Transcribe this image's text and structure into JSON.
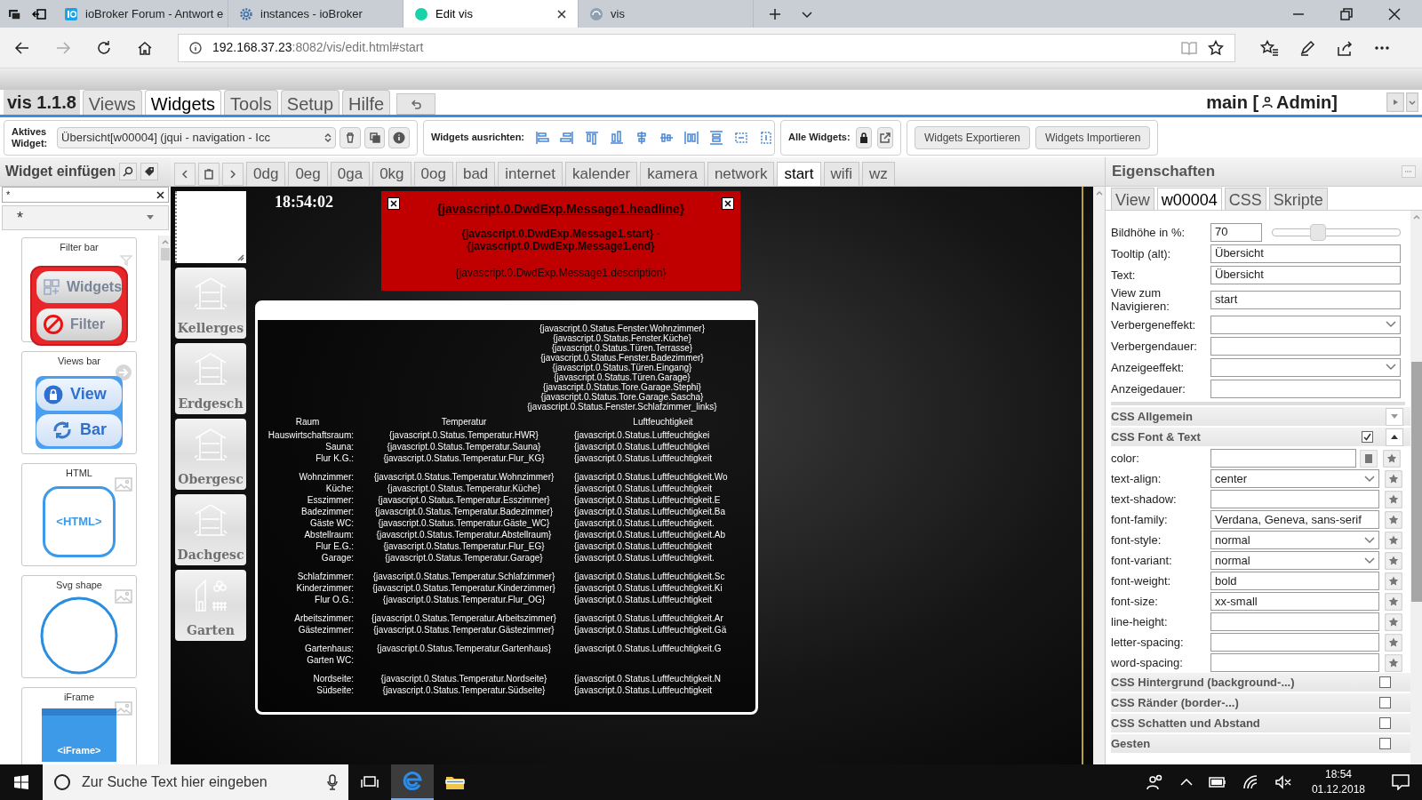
{
  "browser": {
    "tabs": [
      {
        "title": "ioBroker Forum - Antwort e",
        "kind": "logo",
        "selected": false
      },
      {
        "title": "instances - ioBroker",
        "kind": "gear",
        "selected": false
      },
      {
        "title": "Edit vis",
        "kind": "teal",
        "selected": true
      },
      {
        "title": "vis",
        "kind": "grey",
        "selected": false
      }
    ],
    "url_host": "192.168.37.23",
    "url_rest": ":8082/vis/edit.html#start"
  },
  "app": {
    "version": "vis 1.1.8",
    "menu": [
      {
        "label": "Views",
        "selected": false
      },
      {
        "label": "Widgets",
        "selected": true
      },
      {
        "label": "Tools",
        "selected": false
      },
      {
        "label": "Setup",
        "selected": false
      },
      {
        "label": "Hilfe",
        "selected": false
      }
    ],
    "project": "main [",
    "user": "Admin]"
  },
  "toolbar": {
    "active_widget_label": "Aktives Widget:",
    "active_widget": "Übersicht[w00004] (jqui - navigation - Icc",
    "align_label": "Widgets ausrichten:",
    "all_widgets_label": "Alle Widgets:",
    "buttons": [
      "Widgets Exportieren",
      "Widgets Importieren"
    ]
  },
  "palette": {
    "title": "Widget einfügen",
    "filter": "*",
    "set": "*",
    "widgets": [
      {
        "title": "Filter bar",
        "kind": "filter",
        "labels": [
          "Widgets",
          "Filter"
        ]
      },
      {
        "title": "Views bar",
        "kind": "views",
        "labels": [
          "View",
          "Bar"
        ]
      },
      {
        "title": "HTML",
        "kind": "html",
        "labels": [
          "<HTML>"
        ]
      },
      {
        "title": "Svg shape",
        "kind": "svg"
      },
      {
        "title": "iFrame",
        "kind": "iframe",
        "labels": [
          "<iFrame>"
        ]
      }
    ]
  },
  "views": [
    {
      "label": "0dg",
      "selected": false
    },
    {
      "label": "0eg",
      "selected": false
    },
    {
      "label": "0ga",
      "selected": false
    },
    {
      "label": "0kg",
      "selected": false
    },
    {
      "label": "0og",
      "selected": false
    },
    {
      "label": "bad",
      "selected": false
    },
    {
      "label": "internet",
      "selected": false
    },
    {
      "label": "kalender",
      "selected": false
    },
    {
      "label": "kamera",
      "selected": false
    },
    {
      "label": "network",
      "selected": false
    },
    {
      "label": "start",
      "selected": true
    },
    {
      "label": "wifi",
      "selected": false
    },
    {
      "label": "wz",
      "selected": false
    }
  ],
  "canvas": {
    "clock": "18:54:02",
    "nav_buttons": [
      "Kellerges",
      "Erdgesch",
      "Obergesc",
      "Dachgesc",
      "Garten"
    ],
    "alert": {
      "headline": "{javascript.0.DwdExp.Message1.headline}",
      "period_start": "{javascript.0.DwdExp.Message1.start} -",
      "period_end": "{javascript.0.DwdExp.Message1.end}",
      "description": "{javascript.0.DwdExp.Message1.description}"
    },
    "status_lines": [
      "{javascript.0.Status.Fenster.Wohnzimmer}",
      "{javascript.0.Status.Fenster.Küche}",
      "{javascript.0.Status.Türen.Terrasse}",
      "{javascript.0.Status.Fenster.Badezimmer}",
      "{javascript.0.Status.Türen.Eingang}",
      "{javascript.0.Status.Türen.Garage}",
      "{javascript.0.Status.Tore.Garage.Stephi}",
      "{javascript.0.Status.Tore.Garage.Sascha}",
      "{javascript.0.Status.Fenster.Schlafzimmer_links}"
    ],
    "table": {
      "columns": [
        "Raum",
        "Temperatur",
        "Luftfeuchtigkeit"
      ],
      "groups": [
        [
          {
            "room": "Hauswirtschaftsraum:",
            "temperature": "{javascript.0.Status.Temperatur.HWR}",
            "humidity": "{javascript.0.Status.Luftfeuchtigkei"
          },
          {
            "room": "Sauna:",
            "temperature": "{javascript.0.Status.Temperatur.Sauna}",
            "humidity": "{javascript.0.Status.Luftfeuchtigkei"
          },
          {
            "room": "Flur K.G.:",
            "temperature": "{javascript.0.Status.Temperatur.Flur_KG}",
            "humidity": "{javascript.0.Status.Luftfeuchtigkeit"
          }
        ],
        [
          {
            "room": "Wohnzimmer:",
            "temperature": "{javascript.0.Status.Temperatur.Wohnzimmer}",
            "humidity": "{javascript.0.Status.Luftfeuchtigkeit.Wo"
          },
          {
            "room": "Küche:",
            "temperature": "{javascript.0.Status.Temperatur.Küche}",
            "humidity": "{javascript.0.Status.Luftfeuchtigkeit"
          },
          {
            "room": "Esszimmer:",
            "temperature": "{javascript.0.Status.Temperatur.Esszimmer}",
            "humidity": "{javascript.0.Status.Luftfeuchtigkeit.E"
          },
          {
            "room": "Badezimmer:",
            "temperature": "{javascript.0.Status.Temperatur.Badezimmer}",
            "humidity": "{javascript.0.Status.Luftfeuchtigkeit.Ba"
          },
          {
            "room": "Gäste WC:",
            "temperature": "{javascript.0.Status.Temperatur.Gäste_WC}",
            "humidity": "{javascript.0.Status.Luftfeuchtigkeit."
          },
          {
            "room": "Abstellraum:",
            "temperature": "{javascript.0.Status.Temperatur.Abstellraum}",
            "humidity": "{javascript.0.Status.Luftfeuchtigkeit.Ab"
          },
          {
            "room": "Flur E.G.:",
            "temperature": "{javascript.0.Status.Temperatur.Flur_EG}",
            "humidity": "{javascript.0.Status.Luftfeuchtigkeit"
          },
          {
            "room": "Garage:",
            "temperature": "{javascript.0.Status.Temperatur.Garage}",
            "humidity": "{javascript.0.Status.Luftfeuchtigkeit."
          }
        ],
        [
          {
            "room": "Schlafzimmer:",
            "temperature": "{javascript.0.Status.Temperatur.Schlafzimmer}",
            "humidity": "{javascript.0.Status.Luftfeuchtigkeit.Sc"
          },
          {
            "room": "Kinderzimmer:",
            "temperature": "{javascript.0.Status.Temperatur.Kinderzimmer}",
            "humidity": "{javascript.0.Status.Luftfeuchtigkeit.Ki"
          },
          {
            "room": "Flur O.G.:",
            "temperature": "{javascript.0.Status.Temperatur.Flur_OG}",
            "humidity": "{javascript.0.Status.Luftfeuchtigkeit"
          }
        ],
        [
          {
            "room": "Arbeitszimmer:",
            "temperature": "{javascript.0.Status.Temperatur.Arbeitszimmer}",
            "humidity": "{javascript.0.Status.Luftfeuchtigkeit.Ar"
          },
          {
            "room": "Gästezimmer:",
            "temperature": "{javascript.0.Status.Temperatur.Gästezimmer}",
            "humidity": "{javascript.0.Status.Luftfeuchtigkeit.Gä"
          }
        ],
        [
          {
            "room": "Gartenhaus:",
            "temperature": "{javascript.0.Status.Temperatur.Gartenhaus}",
            "humidity": "{javascript.0.Status.Luftfeuchtigkeit.G"
          },
          {
            "room": "Garten WC:"
          }
        ],
        [
          {
            "room": "Nordseite:",
            "temperature": "{javascript.0.Status.Temperatur.Nordseite}",
            "humidity": "{javascript.0.Status.Luftfeuchtigkeit.N"
          },
          {
            "room": "Südseite:",
            "temperature": "{javascript.0.Status.Temperatur.Südseite}",
            "humidity": "{javascript.0.Status.Luftfeuchtigkeit"
          }
        ]
      ]
    }
  },
  "properties": {
    "title": "Eigenschaften",
    "tabs": [
      {
        "label": "View",
        "selected": false
      },
      {
        "label": "w00004",
        "selected": true
      },
      {
        "label": "CSS",
        "selected": false
      },
      {
        "label": "Skripte",
        "selected": false
      }
    ],
    "fields": [
      {
        "label": "Bildhöhe in %:",
        "value": "70",
        "kind": "slider",
        "level": 0.35
      },
      {
        "label": "Tooltip (alt):",
        "value": "Übersicht",
        "kind": "input"
      },
      {
        "label": "Text:",
        "value": "Übersicht",
        "kind": "input"
      },
      {
        "label": "View zum Navigieren:",
        "value": "start",
        "kind": "input"
      },
      {
        "label": "Verbergeneffekt:",
        "kind": "select"
      },
      {
        "label": "Verbergendauer:",
        "kind": "input"
      },
      {
        "label": "Anzeigeeffekt:",
        "kind": "select"
      },
      {
        "label": "Anzeigedauer:",
        "kind": "input"
      }
    ],
    "groups": [
      {
        "label": "CSS Allgemein",
        "expanded": false
      },
      {
        "label": "CSS Font & Text",
        "checked": true,
        "expanded": true,
        "fields": [
          {
            "label": "color:",
            "kind": "color"
          },
          {
            "label": "text-align:",
            "value": "center",
            "kind": "select"
          },
          {
            "label": "text-shadow:",
            "kind": "input"
          },
          {
            "label": "font-family:",
            "value": "Verdana, Geneva, sans-serif",
            "kind": "input"
          },
          {
            "label": "font-style:",
            "value": "normal",
            "kind": "select"
          },
          {
            "label": "font-variant:",
            "value": "normal",
            "kind": "select"
          },
          {
            "label": "font-weight:",
            "value": "bold",
            "kind": "input"
          },
          {
            "label": "font-size:",
            "value": "xx-small",
            "kind": "input"
          },
          {
            "label": "line-height:",
            "kind": "input"
          },
          {
            "label": "letter-spacing:",
            "kind": "input"
          },
          {
            "label": "word-spacing:",
            "kind": "input"
          }
        ]
      },
      {
        "label": "CSS Hintergrund (background-...)",
        "checked": false
      },
      {
        "label": "CSS Ränder (border-...)",
        "checked": false
      },
      {
        "label": "CSS Schatten und Abstand",
        "checked": false
      },
      {
        "label": "Gesten",
        "checked": false
      }
    ]
  },
  "taskbar": {
    "search_placeholder": "Zur Suche Text hier eingeben",
    "time": "18:54",
    "date": "01.12.2018"
  }
}
